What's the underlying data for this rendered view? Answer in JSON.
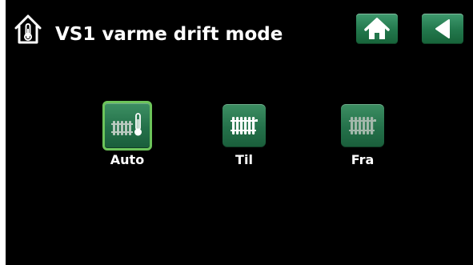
{
  "header": {
    "title": "VS1 varme drift mode",
    "icon": "house-thermometer-icon",
    "home_button_icon": "home-icon",
    "back_button_icon": "back-arrow-icon"
  },
  "modes": [
    {
      "label": "Auto",
      "icon": "radiator-thermometer-icon",
      "selected": true
    },
    {
      "label": "Til",
      "icon": "radiator-icon",
      "selected": false
    },
    {
      "label": "Fra",
      "icon": "radiator-off-icon",
      "selected": false
    }
  ],
  "colors": {
    "background": "#000000",
    "button_green": "#24714a",
    "selected_border": "#6cc45a",
    "text": "#ffffff"
  }
}
